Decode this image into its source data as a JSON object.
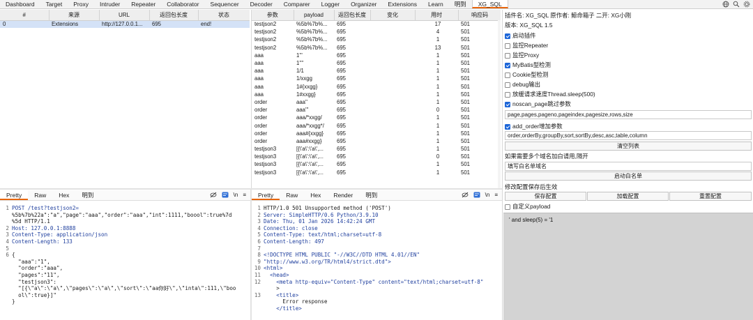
{
  "tabs": [
    "Dashboard",
    "Target",
    "Proxy",
    "Intruder",
    "Repeater",
    "Collaborator",
    "Sequencer",
    "Decoder",
    "Comparer",
    "Logger",
    "Organizer",
    "Extensions",
    "Learn",
    "明到",
    "XG_SQL"
  ],
  "left_table": {
    "headers": [
      "#",
      "来源",
      "URL",
      "返回包长度",
      "状态"
    ],
    "rows": [
      [
        "0",
        "Extensions",
        "http://127.0.0.1...",
        "695",
        "end!"
      ]
    ]
  },
  "mid_table": {
    "headers": [
      "参数",
      "payload",
      "返回包长度",
      "变化",
      "用时",
      "响应码"
    ],
    "rows": [
      [
        "testjson2",
        "%5b%7b%...",
        "695",
        "",
        "17",
        "501"
      ],
      [
        "testjson2",
        "%5b%7b%...",
        "695",
        "",
        "4",
        "501"
      ],
      [
        "testjson2",
        "%5b%7b%...",
        "695",
        "",
        "1",
        "501"
      ],
      [
        "testjson2",
        "%5b%7b%...",
        "695",
        "",
        "13",
        "501"
      ],
      [
        "aaa",
        "1'''",
        "695",
        "",
        "1",
        "501"
      ],
      [
        "aaa",
        "1''''",
        "695",
        "",
        "1",
        "501"
      ],
      [
        "aaa",
        "1/1",
        "695",
        "",
        "1",
        "501"
      ],
      [
        "aaa",
        "1/xxgg",
        "695",
        "",
        "1",
        "501"
      ],
      [
        "aaa",
        "1#{xxgg}",
        "695",
        "",
        "1",
        "501"
      ],
      [
        "aaa",
        "1#xxgg}",
        "695",
        "",
        "1",
        "501"
      ],
      [
        "order",
        "aaa''",
        "695",
        "",
        "1",
        "501"
      ],
      [
        "order",
        "aaa'''",
        "695",
        "",
        "0",
        "501"
      ],
      [
        "order",
        "aaa/*xxgg/",
        "695",
        "",
        "1",
        "501"
      ],
      [
        "order",
        "aaa/*xxgg*/",
        "695",
        "",
        "1",
        "501"
      ],
      [
        "order",
        "aaa#{xxgg}",
        "695",
        "",
        "1",
        "501"
      ],
      [
        "order",
        "aaa#xxgg}",
        "695",
        "",
        "1",
        "501"
      ],
      [
        "testjson3",
        "[{\\'a\\':\\'a\\',...",
        "695",
        "",
        "1",
        "501"
      ],
      [
        "testjson3",
        "[{\\'a\\':\\'a\\',...",
        "695",
        "",
        "0",
        "501"
      ],
      [
        "testjson3",
        "[{\\'a\\':\\'a\\',...",
        "695",
        "",
        "1",
        "501"
      ],
      [
        "testjson3",
        "[{\\'a\\':\\'a\\',...",
        "695",
        "",
        "1",
        "501"
      ]
    ]
  },
  "config": {
    "plugin_info": "插件名: XG_SQL  原作者: 鲸命箱子  二开: XG小刚",
    "version": "版本: XG_SQL 1.5",
    "options": [
      {
        "label": "启动插件",
        "checked": true
      },
      {
        "label": "监控Repeater",
        "checked": false
      },
      {
        "label": "监控Proxy",
        "checked": false
      },
      {
        "label": "MyBatis型检测",
        "checked": true
      },
      {
        "label": "Cookie型检测",
        "checked": false
      },
      {
        "label": "debug输出",
        "checked": false
      },
      {
        "label": "放缓请求速度Thread.sleep(500)",
        "checked": false
      },
      {
        "label": "noscan_page跳过参数",
        "checked": true
      }
    ],
    "noscan_value": "page,pages,pageno,pageindex,pagesize,rows,size",
    "add_order_label": "add_order增加参数",
    "add_order_checked": true,
    "add_order_value": "order,orderBy,groupBy,sort,sortBy,desc,asc,table,column",
    "clear_button": "清空列表",
    "whitelist_hint": "如果需要多个域名加白请用,隔开",
    "whitelist_placeholder": "填写白名单域名",
    "whitelist_button": "启动白名单",
    "save_hint": "修改配置保存后生效",
    "save_button": "保存配置",
    "load_button": "加载配置",
    "reset_button": "重置配置",
    "custom_payload_label": "自定义payload",
    "custom_payload_checked": false,
    "payload_text": "' and sleep(5) = '1"
  },
  "request": {
    "tabs": [
      "Pretty",
      "Raw",
      "Hex",
      "明到"
    ],
    "lines": [
      {
        "n": "1",
        "t": "POST /test?testjson2="
      },
      {
        "n": "",
        "t": "%5b%7b%22a\":\"a\",\"page\":\"aaa\",\"order\":\"aaa\",\"int\":1111,\"boool\":true%7d"
      },
      {
        "n": "",
        "t": "%5d HTTP/1.1"
      },
      {
        "n": "2",
        "t": "Host: 127.0.0.1:8888"
      },
      {
        "n": "3",
        "t": "Content-Type: application/json"
      },
      {
        "n": "4",
        "t": "Content-Length: 133"
      },
      {
        "n": "5",
        "t": ""
      },
      {
        "n": "6",
        "t": "{"
      },
      {
        "n": "",
        "t": "  \"aaa\":\"1\","
      },
      {
        "n": "",
        "t": "  \"order\":\"aaa\","
      },
      {
        "n": "",
        "t": "  \"pages\":\"11\","
      },
      {
        "n": "",
        "t": "  \"testjson3\":"
      },
      {
        "n": "",
        "t": "  \"[{\\\"a\\\":\\\"a\\\",\\\"pages\\\":\\\"a\\\",\\\"sort\\\":\\\"aa你好\\\",\\\"inta\\\":111,\\\"boo"
      },
      {
        "n": "",
        "t": "  ol\\\":true}]\""
      },
      {
        "n": "",
        "t": "}"
      }
    ]
  },
  "response": {
    "tabs": [
      "Pretty",
      "Raw",
      "Hex",
      "Render",
      "明到"
    ],
    "lines": [
      {
        "n": "1",
        "t": "HTTP/1.0 501 Unsupported method ('POST')"
      },
      {
        "n": "2",
        "t": "Server: SimpleHTTP/0.6 Python/3.9.10"
      },
      {
        "n": "3",
        "t": "Date: Thu, 01 Jan 2026 14:42:24 GMT"
      },
      {
        "n": "4",
        "t": "Connection: close"
      },
      {
        "n": "5",
        "t": "Content-Type: text/html;charset=utf-8"
      },
      {
        "n": "6",
        "t": "Content-Length: 497"
      },
      {
        "n": "7",
        "t": ""
      },
      {
        "n": "8",
        "t": "<!DOCTYPE HTML PUBLIC \"-//W3C//DTD HTML 4.01//EN\""
      },
      {
        "n": "9",
        "t": "\"http://www.w3.org/TR/html4/strict.dtd\">"
      },
      {
        "n": "10",
        "t": "<html>"
      },
      {
        "n": "11",
        "t": "  <head>"
      },
      {
        "n": "12",
        "t": "    <meta http-equiv=\"Content-Type\" content=\"text/html;charset=utf-8\""
      },
      {
        "n": "",
        "t": "    >"
      },
      {
        "n": "13",
        "t": "    <title>"
      },
      {
        "n": "",
        "t": "      Error response"
      },
      {
        "n": "",
        "t": "    </title>"
      }
    ]
  }
}
